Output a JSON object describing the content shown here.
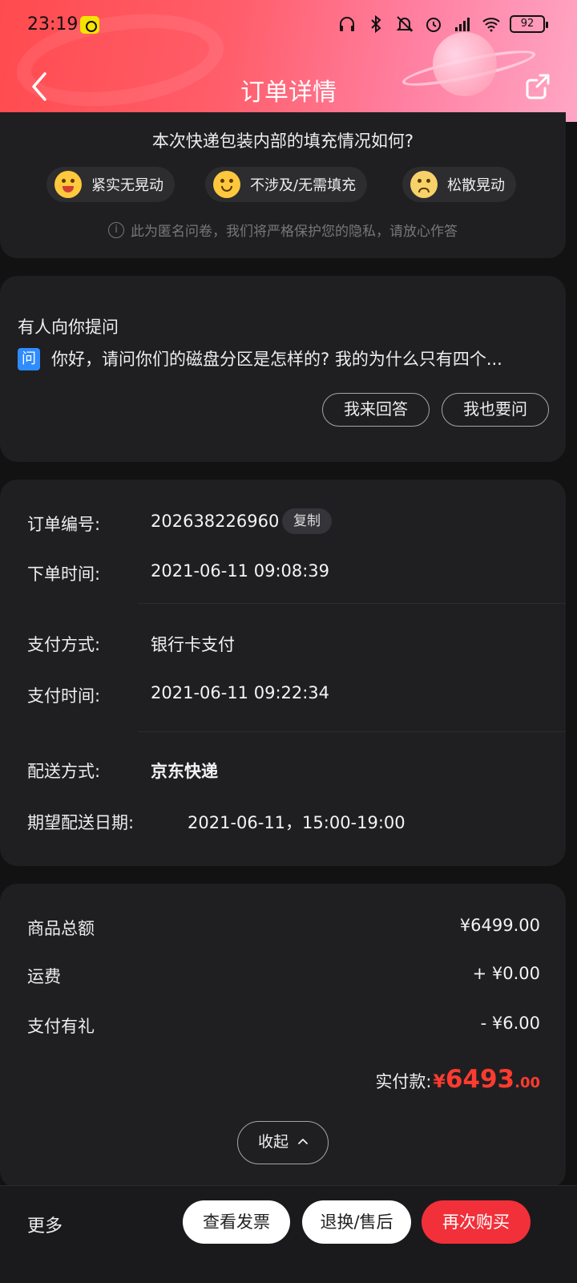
{
  "status_bar": {
    "time": "23:19",
    "battery": "92"
  },
  "header": {
    "title": "订单详情"
  },
  "survey": {
    "question": "本次快递包装内部的填充情况如何?",
    "options": [
      {
        "label": "紧实无晃动",
        "icon": "laughing-face-icon"
      },
      {
        "label": "不涉及/无需填充",
        "icon": "smiling-face-icon"
      },
      {
        "label": "松散晃动",
        "icon": "worried-face-icon"
      }
    ],
    "note": "此为匿名问卷，我们将严格保护您的隐私，请放心作答"
  },
  "qa": {
    "title": "有人向你提问",
    "badge": "问",
    "question": "你好，请问你们的磁盘分区是怎样的? 我的为什么只有四个...",
    "answer_button": "我来回答",
    "ask_button": "我也要问"
  },
  "order_info": {
    "order_no_label": "订单编号:",
    "order_no": "202638226960",
    "copy_button": "复制",
    "order_time_label": "下单时间:",
    "order_time": "2021-06-11 09:08:39",
    "pay_method_label": "支付方式:",
    "pay_method": "银行卡支付",
    "pay_time_label": "支付时间:",
    "pay_time": "2021-06-11 09:22:34",
    "delivery_label": "配送方式:",
    "delivery": "京东快递",
    "expected_label": "期望配送日期:",
    "expected": "2021-06-11，15:00-19:00"
  },
  "price": {
    "subtotal_label": "商品总额",
    "subtotal": "¥6499.00",
    "shipping_label": "运费",
    "shipping": "+ ¥0.00",
    "gift_label": "支付有礼",
    "gift": "- ¥6.00",
    "paid_label": "实付款:",
    "paid_yen": "¥",
    "paid_int": "6493",
    "paid_dec": ".00",
    "collapse_button": "收起"
  },
  "bottom_bar": {
    "more": "更多",
    "invoice_button": "查看发票",
    "return_button": "退换/售后",
    "rebuy_button": "再次购买"
  },
  "colors": {
    "accent_red": "#f2303a",
    "price_red": "#ff3b30",
    "card_bg": "#1f1f21",
    "page_bg": "#121212"
  }
}
